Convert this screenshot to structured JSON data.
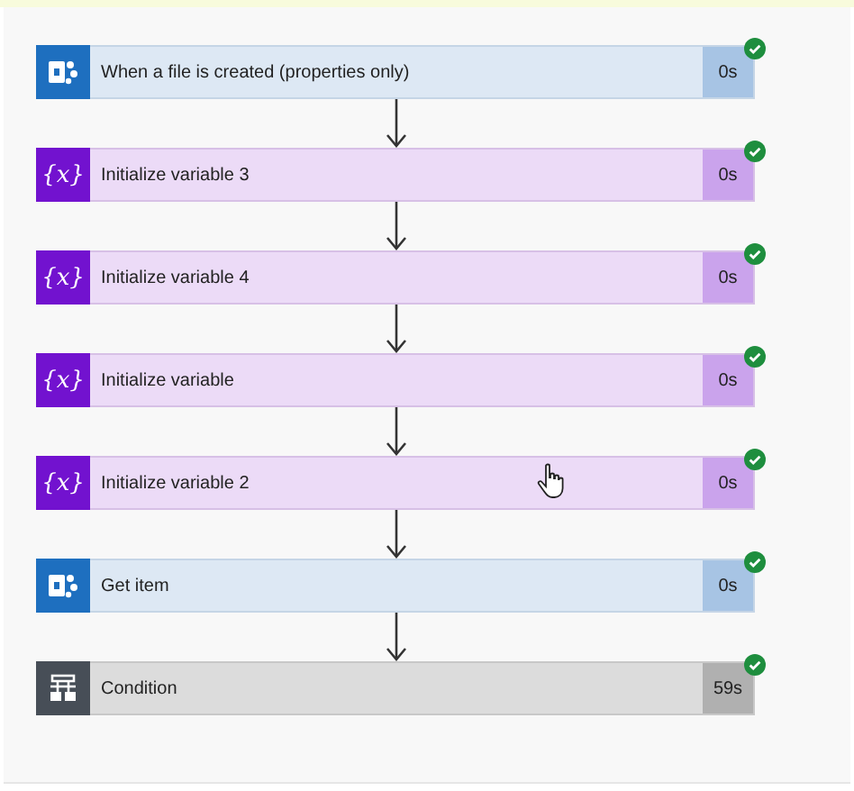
{
  "steps": [
    {
      "kind": "sharepoint",
      "label": "When a file is created (properties only)",
      "duration": "0s",
      "succeeded": true
    },
    {
      "kind": "variable",
      "icon_text": "{x}",
      "label": "Initialize variable 3",
      "duration": "0s",
      "succeeded": true
    },
    {
      "kind": "variable",
      "icon_text": "{x}",
      "label": "Initialize variable 4",
      "duration": "0s",
      "succeeded": true
    },
    {
      "kind": "variable",
      "icon_text": "{x}",
      "label": "Initialize variable",
      "duration": "0s",
      "succeeded": true
    },
    {
      "kind": "variable",
      "icon_text": "{x}",
      "label": "Initialize variable 2",
      "duration": "0s",
      "succeeded": true
    },
    {
      "kind": "sharepoint",
      "label": "Get item",
      "duration": "0s",
      "succeeded": true
    },
    {
      "kind": "condition",
      "label": "Condition",
      "duration": "59s",
      "succeeded": true
    }
  ]
}
